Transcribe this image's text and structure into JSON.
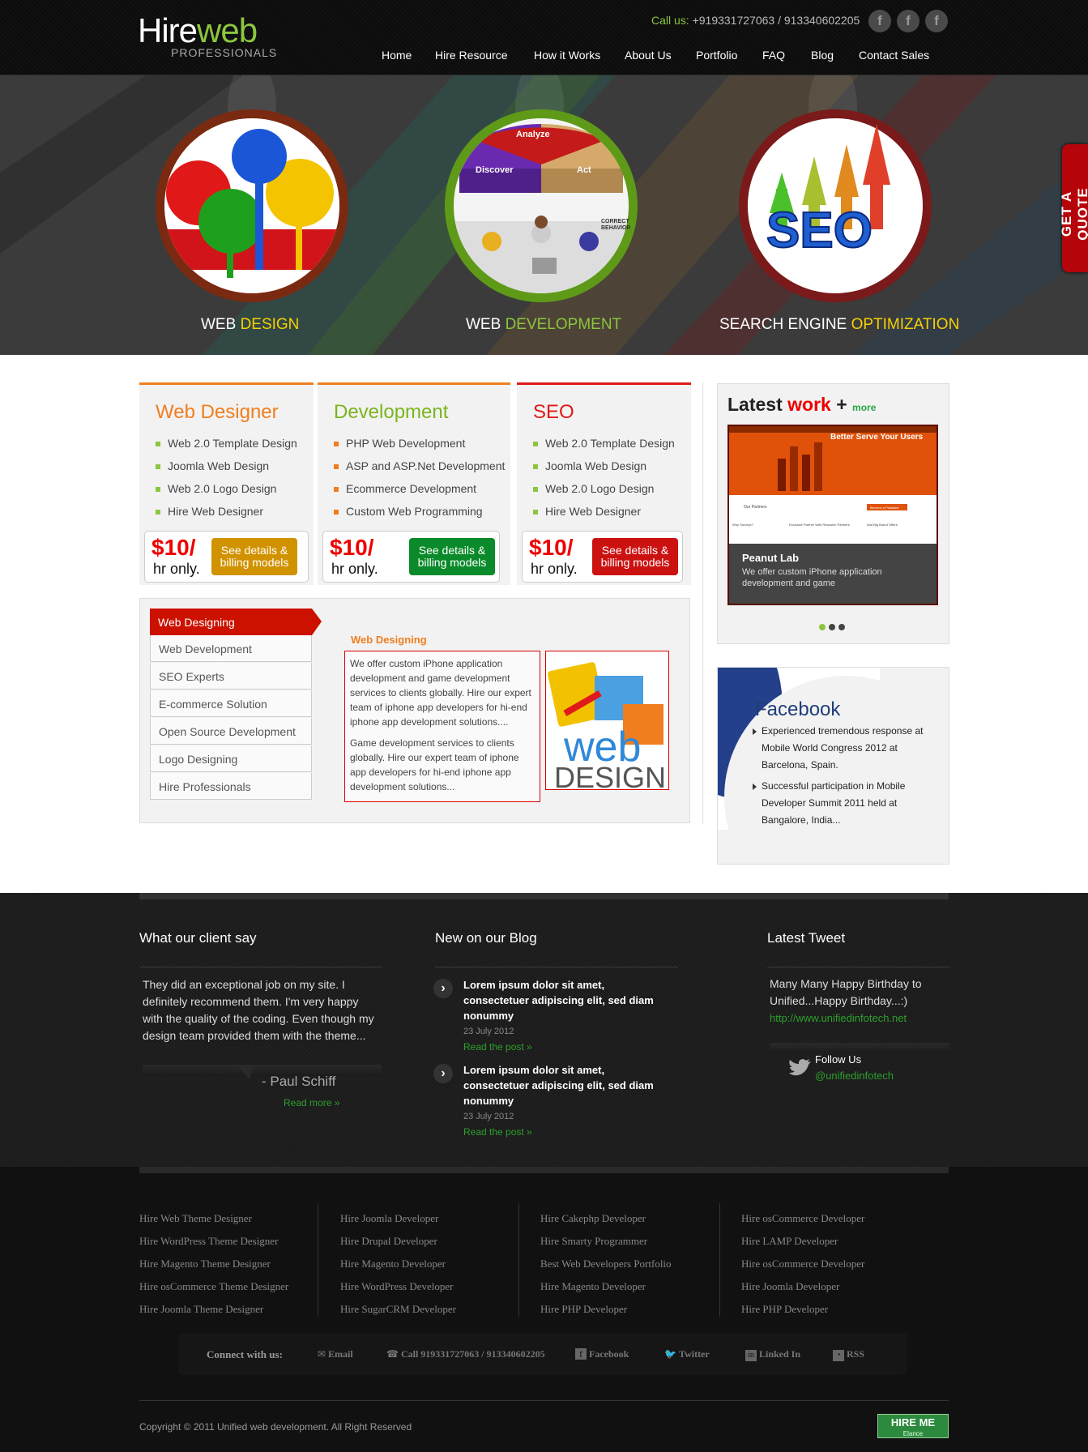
{
  "brand": {
    "part1": "Hire",
    "part2": "web",
    "sub": "PROFESSIONALS"
  },
  "header": {
    "call_label": "Call us:",
    "phones": "+919331727063 / 913340602205",
    "social_glyph": "f"
  },
  "nav": [
    "Home",
    "Hire Resource",
    "How it Works",
    "About Us",
    "Portfolio",
    "FAQ",
    "Blog",
    "Contact Sales"
  ],
  "banner": [
    {
      "white": "WEB ",
      "color": "DESIGN"
    },
    {
      "white": "WEB ",
      "color": "DEVELOPMENT",
      "circle_words": [
        "Analyze",
        "Discover",
        "Act",
        "CORRECT",
        "BEHAVIOR"
      ]
    },
    {
      "white": "SEARCH ENGINE ",
      "color": "OPTIMIZATION",
      "circle_word": "SEO"
    }
  ],
  "quote_tab": "GET A QUOTE",
  "services": [
    {
      "title": "Web Designer",
      "title_color": "#f07e1e",
      "items": [
        "Web 2.0 Template Design",
        "Joomla Web Design",
        "Web 2.0 Logo Design",
        "Hire Web Designer"
      ],
      "price": "$10/",
      "unit": "hr only.",
      "button": "See details & billing models",
      "button_color": "#d19200"
    },
    {
      "title": "Development",
      "title_color": "#7bb51b",
      "items": [
        "PHP Web Development",
        "ASP and ASP.Net Development",
        "Ecommerce Development",
        "Custom Web Programming"
      ],
      "price": "$10/",
      "unit": "hr only.",
      "button": "See details & billing models",
      "button_color": "#0a8a2a"
    },
    {
      "title": "SEO",
      "title_color": "#e01a1a",
      "items": [
        "Web 2.0 Template Design",
        "Joomla Web Design",
        "Web 2.0 Logo Design",
        "Hire Web Designer"
      ],
      "price": "$10/",
      "unit": "hr only.",
      "button": "See details & billing models",
      "button_color": "#cc1111"
    }
  ],
  "tabs": [
    "Web Designing",
    "Web Development",
    "SEO Experts",
    "E-commerce Solution",
    "Open Source Development",
    "Logo Designing",
    "Hire Professionals"
  ],
  "tab_content": {
    "heading": "Web Designing",
    "p1": "We offer custom iPhone application development and game development services to clients globally. Hire our expert team of iphone app developers for hi-end iphone app development solutions....",
    "p2": "Game development services to clients globally. Hire our expert team of iphone app developers for hi-end iphone app development solutions...",
    "img_word1": "web",
    "img_word2": "DESIGN"
  },
  "latest_work": {
    "t1": "Latest ",
    "t2": "work",
    "plus": " +",
    "more": "more",
    "shot_headline": "Better Serve Your Users",
    "shot_partners": "Our Partners",
    "shot_cta": "Become a Publisher",
    "shot_cols": [
      "Why Surveys?",
      "Exclusive Partner With Research Partners",
      "Add Big Brand Offers"
    ],
    "caption_title": "Peanut Lab",
    "caption_text": "We offer custom iPhone application development and game"
  },
  "facebook": {
    "title": "Facebook",
    "items": [
      "Experienced tremendous response at Mobile World Congress 2012 at Barcelona, Spain.",
      "Successful participation in Mobile Developer Summit 2011 held at Bangalore, India..."
    ]
  },
  "clients": {
    "title": "What our client say",
    "quote": "They did an exceptional job on my site. I definitely recommend them. I'm very happy with the quality of the coding. Even though my design team provided them with the theme...",
    "author": "- Paul Schiff",
    "more": "Read more »"
  },
  "blog": {
    "title": "New on our Blog",
    "posts": [
      {
        "title": "Lorem ipsum dolor sit amet, consectetuer adipiscing elit, sed diam nonummy",
        "date": "23 July 2012",
        "more": "Read the post »"
      },
      {
        "title": "Lorem ipsum dolor sit amet, consectetuer adipiscing elit, sed diam nonummy",
        "date": "23 July 2012",
        "more": "Read the post »"
      }
    ]
  },
  "tweet": {
    "title": "Latest Tweet",
    "text": "Many Many Happy Birthday to Unified...Happy Birthday...:)",
    "link": "http://www.unifiedinfotech.net",
    "follow": "Follow Us",
    "handle": "@unifiedinfotech"
  },
  "footer_links": [
    [
      "Hire Web Theme Designer",
      "Hire WordPress Theme Designer",
      "Hire Magento Theme Designer",
      "Hire osCommerce Theme Designer",
      "Hire Joomla Theme Designer"
    ],
    [
      "Hire Joomla Developer",
      "Hire Drupal Developer",
      "Hire Magento Developer",
      "Hire WordPress Developer",
      "Hire SugarCRM Developer"
    ],
    [
      "Hire Cakephp Developer",
      "Hire Smarty Programmer",
      "Best Web Developers Portfolio",
      "Hire Magento Developer",
      "Hire PHP Developer"
    ],
    [
      "Hire osCommerce Developer",
      "Hire LAMP Developer",
      "Hire osCommerce Developer",
      "Hire Joomla Developer",
      "Hire PHP Developer"
    ]
  ],
  "connect": {
    "label": "Connect with us:",
    "items": [
      "Email",
      "Call 919331727063 / 913340602205",
      "Facebook",
      "Twitter",
      "Linked In",
      "RSS"
    ]
  },
  "copyright": "Copyright © 2011 Unified web development. All Right Reserved",
  "hireme": {
    "l1": "HIRE ME",
    "l2": "Elance"
  }
}
